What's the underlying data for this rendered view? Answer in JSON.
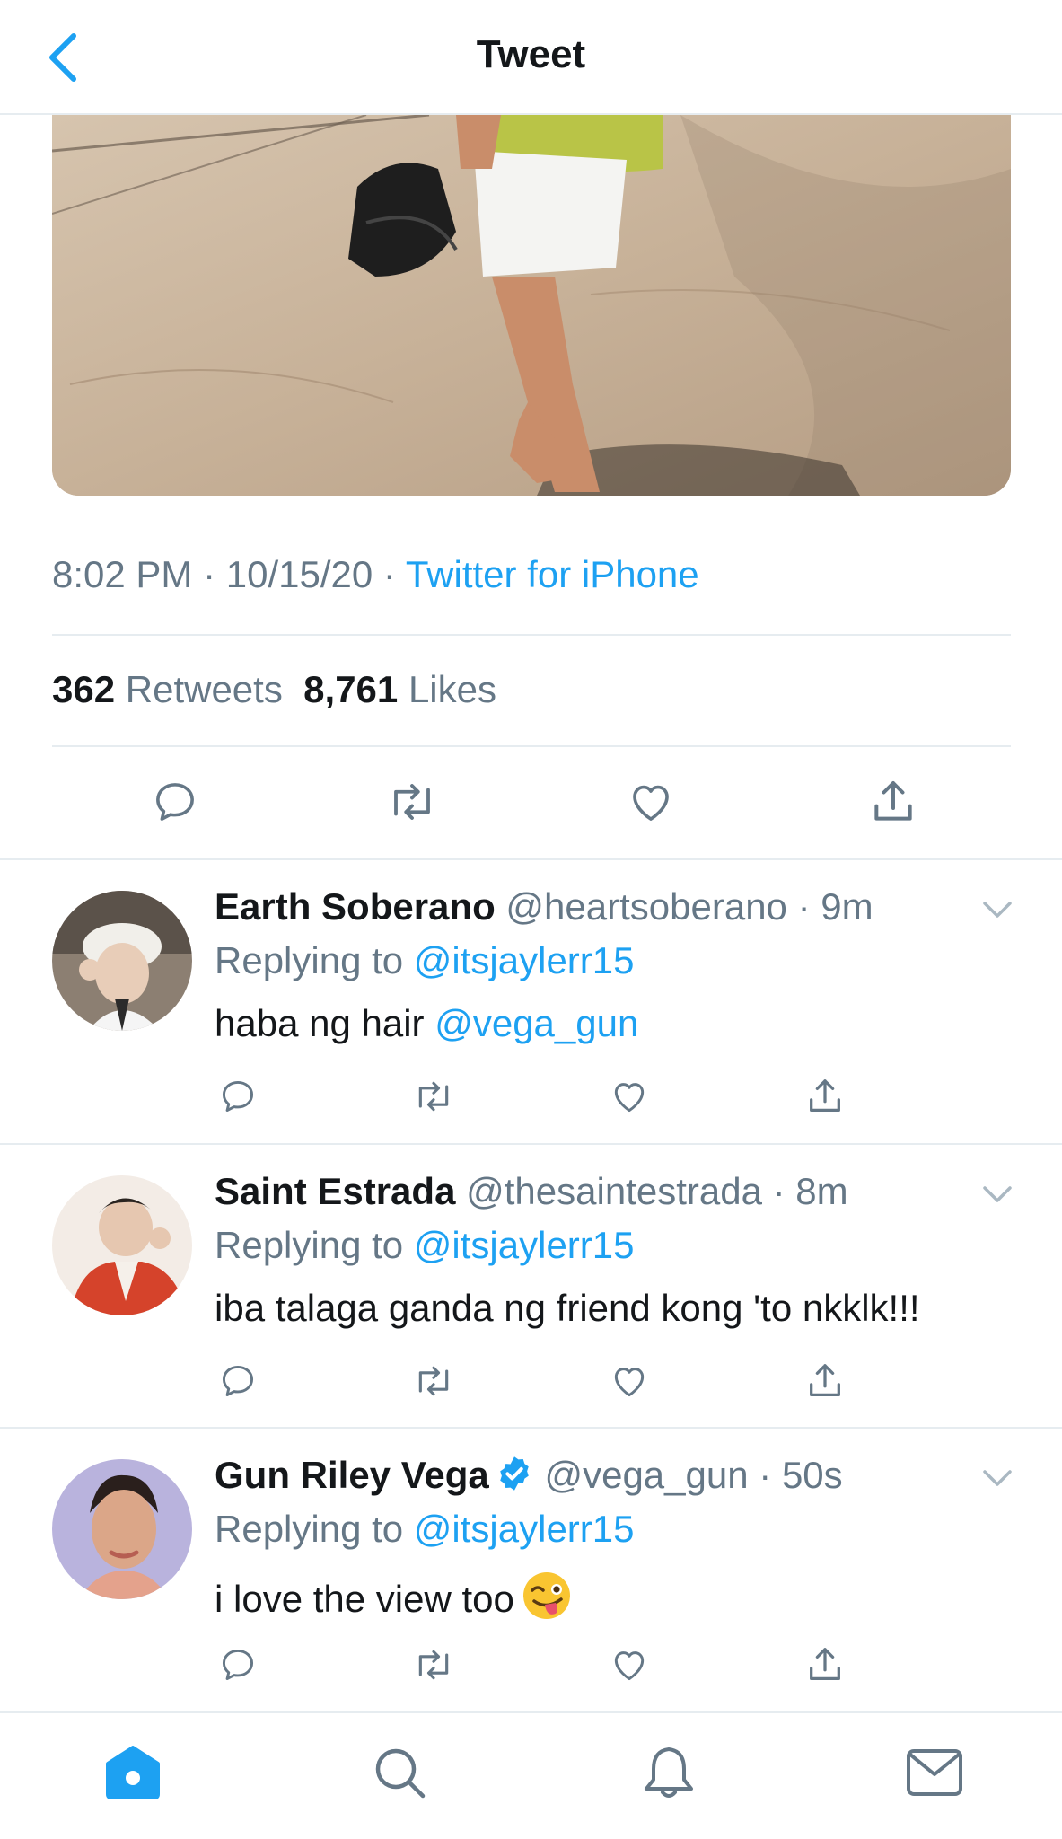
{
  "header": {
    "title": "Tweet",
    "back_icon": "chevron-left-icon"
  },
  "tweet": {
    "time": "8:02 PM",
    "date": "10/15/20",
    "source": "Twitter for iPhone",
    "retweets": "362",
    "retweets_label": "Retweets",
    "likes": "8,761",
    "likes_label": "Likes"
  },
  "replies": [
    {
      "name": "Earth Soberano",
      "handle": "@heartsoberano",
      "time": "9m",
      "replying_label": "Replying to",
      "replying_to": "@itsjaylerr15",
      "text": "haba ng hair ",
      "mention": "@vega_gun",
      "verified": false
    },
    {
      "name": "Saint Estrada",
      "handle": "@thesaintestrada",
      "time": "8m",
      "replying_label": "Replying to",
      "replying_to": "@itsjaylerr15",
      "text": "iba talaga ganda ng friend kong 'to nkklk!!!",
      "mention": "",
      "verified": false
    },
    {
      "name": "Gun Riley Vega",
      "handle": "@vega_gun",
      "time": "50s",
      "replying_label": "Replying to",
      "replying_to": "@itsjaylerr15",
      "text": "i love the view too",
      "mention": "",
      "verified": true
    }
  ],
  "separator": " · ",
  "tabbar": {
    "items": [
      "home-icon",
      "search-icon",
      "bell-icon",
      "mail-icon"
    ],
    "active": "home-icon"
  },
  "colors": {
    "accent": "#1da1f2",
    "text": "#14171a",
    "muted": "#657786",
    "divider": "#e6ecf0"
  }
}
